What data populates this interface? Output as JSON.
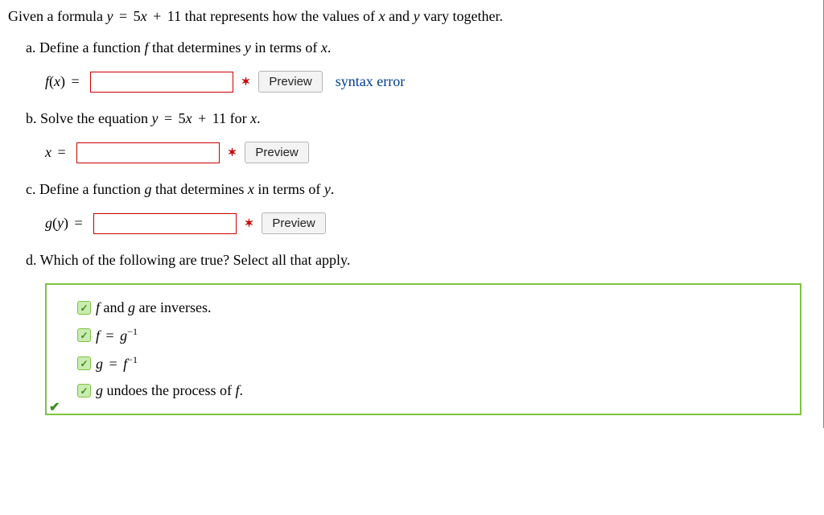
{
  "intro": {
    "text_prefix": "Given a formula ",
    "formula": "y = 5x + 11",
    "text_suffix": " that represents how the values of x and y vary together."
  },
  "parts": {
    "a": {
      "label": "a. Define a function f that determines y in terms of x.",
      "lhs": "f(x) =",
      "preview": "Preview",
      "error": "syntax error"
    },
    "b": {
      "label_prefix": "b. Solve the equation ",
      "label_formula": "y = 5x + 11",
      "label_suffix": " for x.",
      "lhs": "x =",
      "preview": "Preview"
    },
    "c": {
      "label": "c. Define a function g that determines x in terms of y.",
      "lhs": "g(y) =",
      "preview": "Preview"
    },
    "d": {
      "label": "d. Which of the following are true? Select all that apply.",
      "options": {
        "o1": "f and g are inverses.",
        "o2_plain": "f = g",
        "o2_sup": "−1",
        "o3_plain": "g = f",
        "o3_sup": "−1",
        "o4": "g undoes the process of f."
      }
    }
  },
  "icons": {
    "wrong": "✶"
  }
}
